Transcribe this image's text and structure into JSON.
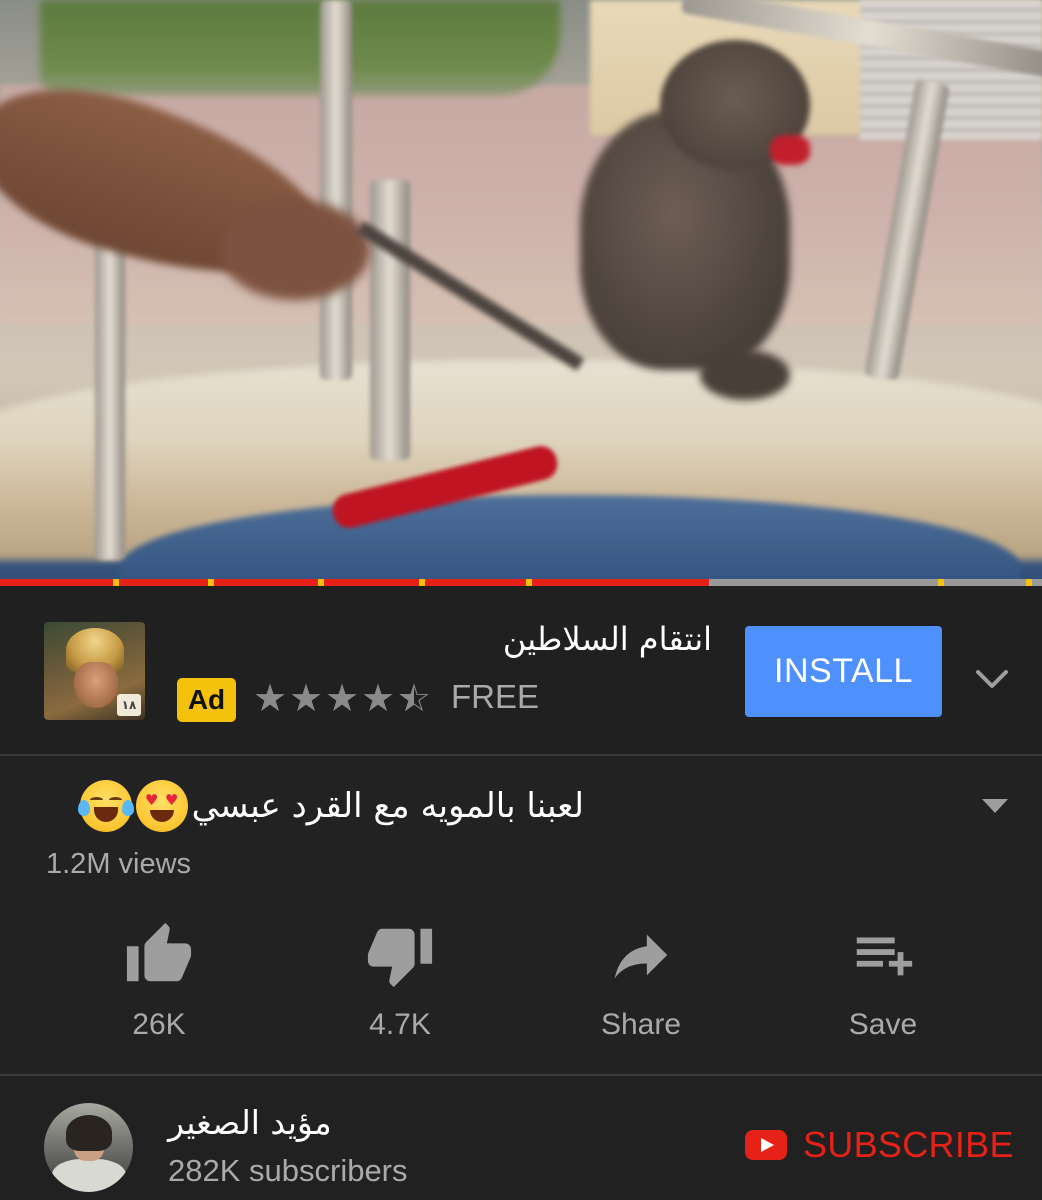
{
  "player": {
    "progress_played_fraction": 0.68,
    "ad_marker_fractions": [
      0.108,
      0.2,
      0.305,
      0.402,
      0.505,
      0.9,
      0.985
    ]
  },
  "ad": {
    "title": "انتقام السلاطين",
    "badge": "Ad",
    "rating": 4.5,
    "price": "FREE",
    "install_label": "INSTALL",
    "icon_badge": "١٨",
    "colors": {
      "install": "#4d90fe",
      "badge": "#f4c20d"
    }
  },
  "video": {
    "title": "لعبنا بالمويه مع القرد عبسي",
    "views": "1.2M views"
  },
  "actions": {
    "like": {
      "label": "26K",
      "icon": "thumbs-up-icon"
    },
    "dislike": {
      "label": "4.7K",
      "icon": "thumbs-down-icon"
    },
    "share": {
      "label": "Share",
      "icon": "share-icon"
    },
    "save": {
      "label": "Save",
      "icon": "playlist-add-icon"
    }
  },
  "channel": {
    "name": "مؤيد الصغير",
    "subscribers": "282K subscribers",
    "subscribe_label": "SUBSCRIBE",
    "colors": {
      "subscribe": "#e62117"
    }
  }
}
